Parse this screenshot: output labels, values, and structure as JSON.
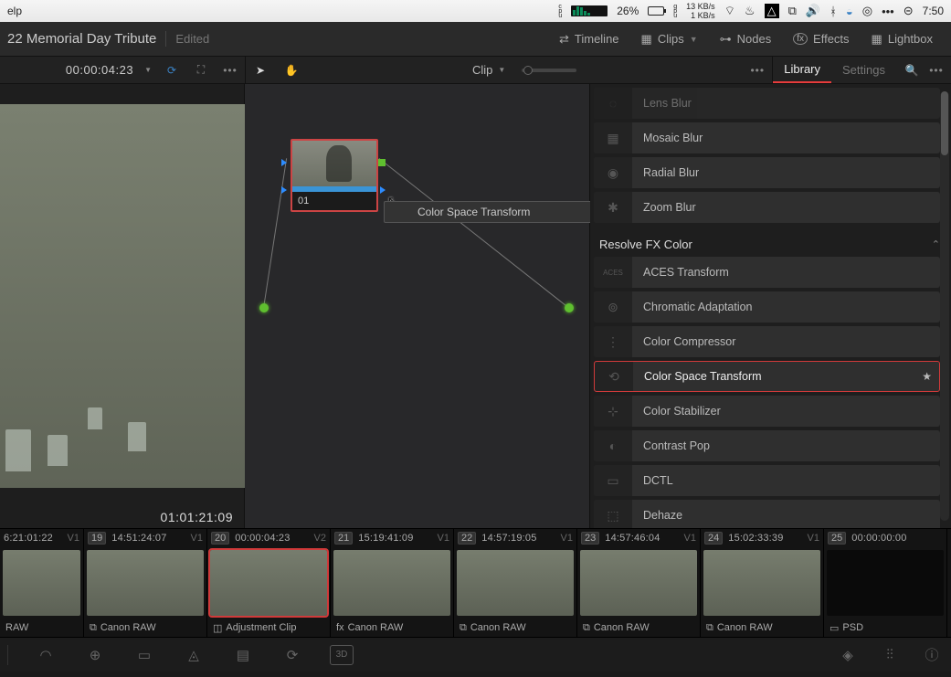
{
  "menubar": {
    "left_item": "elp",
    "cpu_label": "c\np\nu",
    "battery_pct": "26%",
    "gpu_label": "g\np\nu",
    "net_up": "13 KB/s",
    "net_down": "1 KB/s",
    "clock": "7:50"
  },
  "appbar": {
    "title": "22 Memorial Day Tribute",
    "status": "Edited",
    "tabs": {
      "timeline": "Timeline",
      "clips": "Clips",
      "nodes": "Nodes",
      "effects": "Effects",
      "lightbox": "Lightbox"
    }
  },
  "toolrow": {
    "timecode": "00:00:04:23",
    "clip_mode": "Clip",
    "library_tab": "Library",
    "settings_tab": "Settings"
  },
  "viewer": {
    "timecode": "01:01:21:09"
  },
  "node": {
    "label": "01",
    "tooltip": "Color Space Transform"
  },
  "sidebar": {
    "group_blur": [
      {
        "label": "Lens Blur",
        "icon": "◌"
      },
      {
        "label": "Mosaic Blur",
        "icon": "▦"
      },
      {
        "label": "Radial Blur",
        "icon": "◉"
      },
      {
        "label": "Zoom Blur",
        "icon": "✱"
      }
    ],
    "section_title": "Resolve FX Color",
    "group_color": [
      {
        "label": "ACES Transform",
        "icon": "ACES"
      },
      {
        "label": "Chromatic Adaptation",
        "icon": "⊚"
      },
      {
        "label": "Color Compressor",
        "icon": "⋮"
      },
      {
        "label": "Color Space Transform",
        "icon": "⟲",
        "highlighted": true,
        "starred": true
      },
      {
        "label": "Color Stabilizer",
        "icon": "⊹"
      },
      {
        "label": "Contrast Pop",
        "icon": "◐"
      },
      {
        "label": "DCTL",
        "icon": "▭"
      },
      {
        "label": "Dehaze",
        "icon": "⬚"
      }
    ]
  },
  "timeline": {
    "clips": [
      {
        "num": "",
        "tc": "6:21:01:22",
        "track": "V1",
        "format": "RAW",
        "icon": "",
        "thumb": "hands",
        "first": true
      },
      {
        "num": "19",
        "tc": "14:51:24:07",
        "track": "V1",
        "format": "Canon RAW",
        "icon": "cam"
      },
      {
        "num": "20",
        "tc": "00:00:04:23",
        "track": "V2",
        "format": "Adjustment Clip",
        "icon": "adj",
        "selected": true
      },
      {
        "num": "21",
        "tc": "15:19:41:09",
        "track": "V1",
        "format": "Canon RAW",
        "icon": "fx"
      },
      {
        "num": "22",
        "tc": "14:57:19:05",
        "track": "V1",
        "format": "Canon RAW",
        "icon": "cam"
      },
      {
        "num": "23",
        "tc": "14:57:46:04",
        "track": "V1",
        "format": "Canon RAW",
        "icon": "cam"
      },
      {
        "num": "24",
        "tc": "15:02:33:39",
        "track": "V1",
        "format": "Canon RAW",
        "icon": "cam"
      },
      {
        "num": "25",
        "tc": "00:00:00:00",
        "track": "",
        "format": "PSD",
        "icon": "psd",
        "dark": true
      }
    ]
  }
}
